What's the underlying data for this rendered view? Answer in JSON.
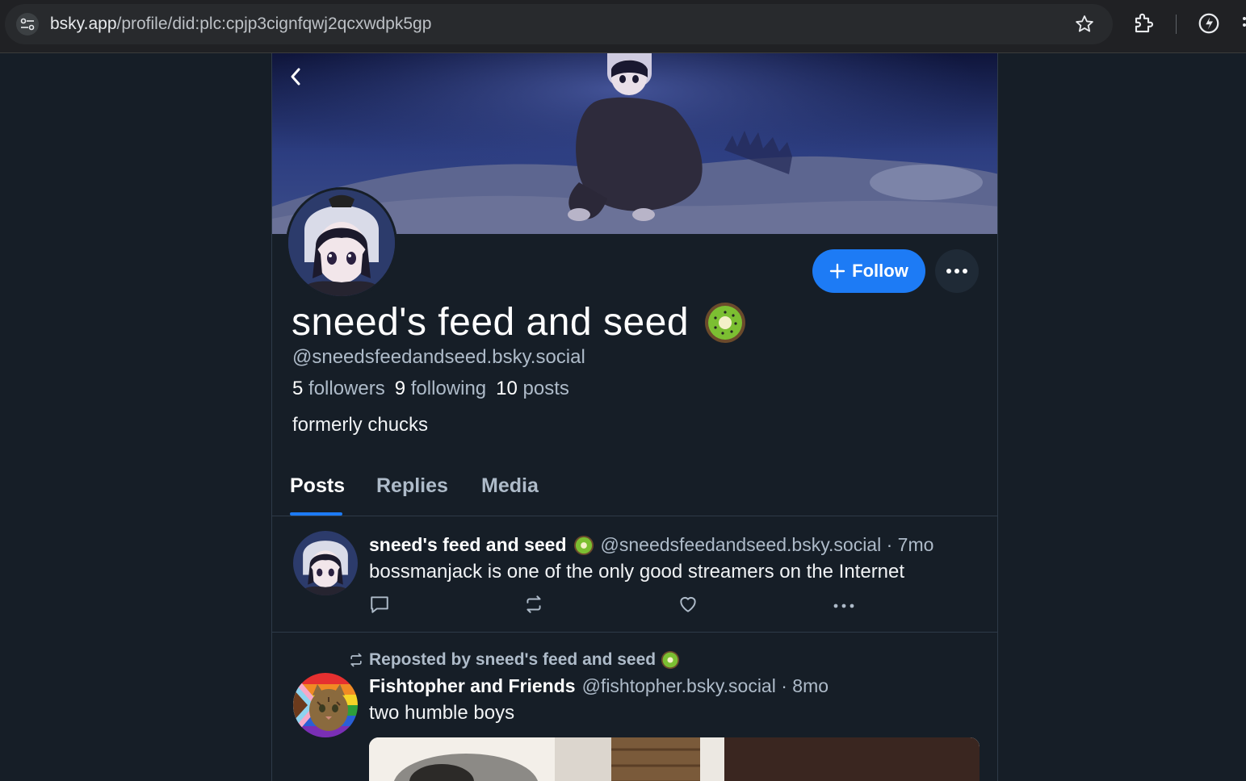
{
  "browser": {
    "url_host": "bsky.app",
    "url_path": "/profile/did:plc:cpjp3cignfqwj2qcxwdpk5gp"
  },
  "profile": {
    "display_name": "sneed's feed and seed",
    "handle": "@sneedsfeedandseed.bsky.social",
    "followers_count": "5",
    "followers_label": "followers",
    "following_count": "9",
    "following_label": "following",
    "posts_count": "10",
    "posts_label": "posts",
    "bio": "formerly chucks",
    "follow_label": "Follow"
  },
  "tabs": [
    {
      "label": "Posts",
      "active": true
    },
    {
      "label": "Replies",
      "active": false
    },
    {
      "label": "Media",
      "active": false
    }
  ],
  "posts": [
    {
      "author": "sneed's feed and seed",
      "meta": "@sneedsfeedandseed.bsky.social · 7mo",
      "text": "bossmanjack is one of the only good streamers on the Internet"
    },
    {
      "repost_label": "Reposted by sneed's feed and seed",
      "author": "Fishtopher and Friends",
      "meta": "@fishtopher.bsky.social · 8mo",
      "text": "two humble boys"
    }
  ],
  "colors": {
    "accent": "#1d7bf5",
    "background": "#161e27",
    "muted_text": "#aebbc9"
  },
  "icons": [
    "tune-icon",
    "star-icon",
    "extension-icon",
    "performance-icon",
    "back-chevron-icon",
    "plus-icon",
    "ellipsis-icon",
    "kiwi-emoji-icon",
    "reply-icon",
    "repost-icon",
    "like-icon"
  ]
}
